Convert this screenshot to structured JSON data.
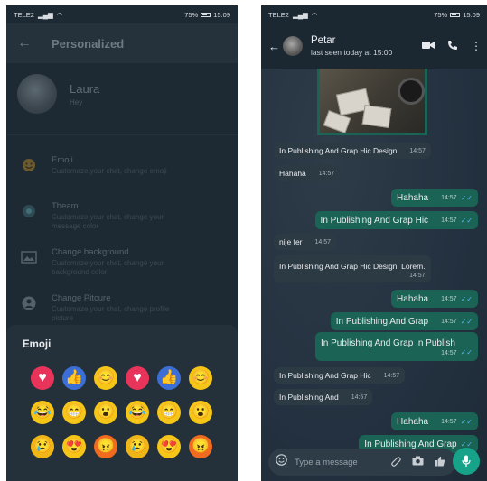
{
  "left": {
    "status": {
      "carrier": "TELE2",
      "battery": "75%",
      "time": "15:09"
    },
    "header": {
      "back_icon": "arrow-left-icon",
      "title": "Personalized"
    },
    "profile": {
      "name": "Laura",
      "status": "Hey"
    },
    "settings": [
      {
        "icon": "emoji-icon",
        "title": "Emoji",
        "desc": "Customaze your chat, change emoji"
      },
      {
        "icon": "theme-icon",
        "title": "Theam",
        "desc": "Customaze your chat, change  your message color"
      },
      {
        "icon": "image-icon",
        "title": "Change background",
        "desc": "Customaze your chat, change your background color"
      },
      {
        "icon": "user-icon",
        "title": "Change Pitcure",
        "desc": "Customaze your chat, change profile picture"
      }
    ],
    "sheet": {
      "title": "Emoji",
      "emojis": [
        "heart",
        "thumbs-up",
        "smile",
        "heart",
        "thumbs-up",
        "smile",
        "laugh-tears",
        "grin",
        "surprised",
        "laugh-tears",
        "grin",
        "surprised",
        "sad",
        "heart-eyes",
        "angry",
        "sad",
        "heart-eyes",
        "angry"
      ]
    }
  },
  "right": {
    "status": {
      "carrier": "TELE2",
      "battery": "75%",
      "time": "15:09"
    },
    "header": {
      "name": "Petar",
      "status": "last seen today at 15:00"
    },
    "messages": [
      {
        "dir": "in",
        "text": "In Publishing And Grap Hic Design",
        "time": "14:57"
      },
      {
        "dir": "in",
        "text": "Hahaha",
        "time": "14:57"
      },
      {
        "dir": "out",
        "text": "Hahaha",
        "time": "14:57"
      },
      {
        "dir": "out",
        "text": "In Publishing And Grap Hic",
        "time": "14:57"
      },
      {
        "dir": "in",
        "text": "nije fer",
        "time": "14:57"
      },
      {
        "dir": "in",
        "text": "In Publishing And Grap Hic Design, Lorem.",
        "time": "14:57"
      },
      {
        "dir": "out",
        "text": "Hahaha",
        "time": "14:57"
      },
      {
        "dir": "out",
        "text": "In Publishing And Grap",
        "time": "14:57"
      },
      {
        "dir": "out",
        "text": "In Publishing And Grap In Publish",
        "time": "14:57"
      },
      {
        "dir": "in",
        "text": "In Publishing And Grap Hic",
        "time": "14:57"
      },
      {
        "dir": "in",
        "text": "In Publishing And",
        "time": "14:57"
      },
      {
        "dir": "out",
        "text": "Hahaha",
        "time": "14:57"
      },
      {
        "dir": "out",
        "text": "In Publishing And Grap",
        "time": ""
      }
    ],
    "input": {
      "placeholder": "Type a message"
    },
    "colors": {
      "accent": "#16a38a",
      "outgoing": "#1a6355",
      "incoming": "#2c3a44",
      "tick": "#4fb6f0"
    }
  }
}
